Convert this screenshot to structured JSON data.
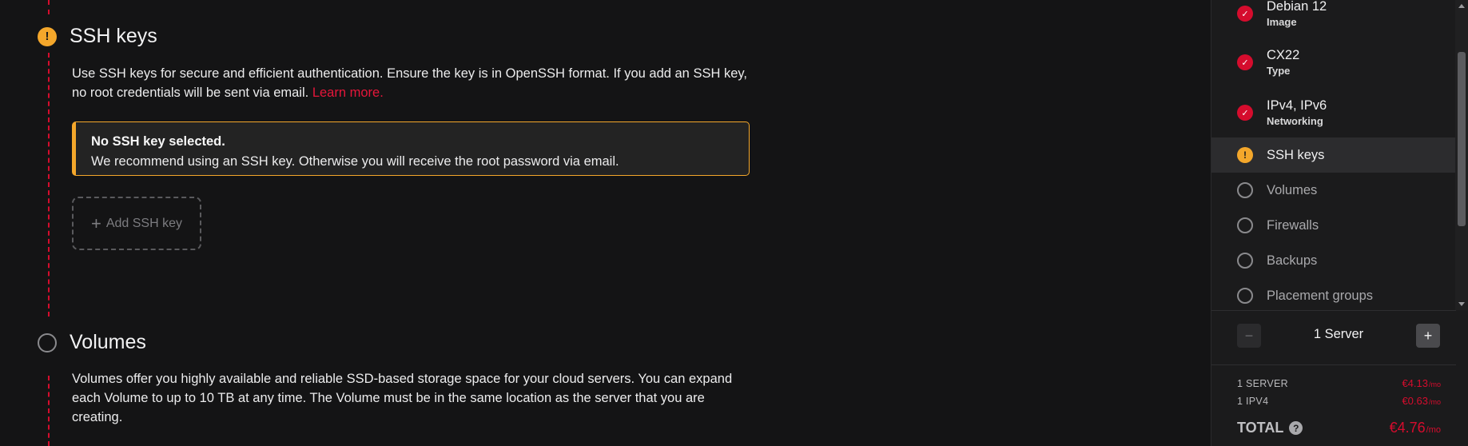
{
  "ssh_section": {
    "title": "SSH keys",
    "status_icon": "!",
    "description": "Use SSH keys for secure and efficient authentication. Ensure the key is in OpenSSH format. If you add an SSH key, no root credentials will be sent via email.",
    "learn_more": "Learn more.",
    "alert": {
      "title": "No SSH key selected.",
      "text": "We recommend using an SSH key. Otherwise you will receive the root password via email."
    },
    "add_button": {
      "icon": "+",
      "label": "Add SSH key"
    }
  },
  "volumes_section": {
    "title": "Volumes",
    "description": "Volumes offer you highly available and reliable SSD-based storage space for your cloud servers. You can expand each Volume to up to 10 TB at any time. The Volume must be in the same location as the server that you are creating."
  },
  "sidebar": {
    "steps": [
      {
        "label": "Debian 12",
        "sub": "Image",
        "status": "done",
        "icon": "✓"
      },
      {
        "label": "CX22",
        "sub": "Type",
        "status": "done",
        "icon": "✓"
      },
      {
        "label": "IPv4, IPv6",
        "sub": "Networking",
        "status": "done",
        "icon": "✓"
      },
      {
        "label": "SSH keys",
        "sub": "",
        "status": "warning",
        "icon": "!"
      },
      {
        "label": "Volumes",
        "sub": "",
        "status": "empty"
      },
      {
        "label": "Firewalls",
        "sub": "",
        "status": "empty"
      },
      {
        "label": "Backups",
        "sub": "",
        "status": "empty"
      },
      {
        "label": "Placement groups",
        "sub": "",
        "status": "empty"
      }
    ],
    "quantity": {
      "minus": "−",
      "plus": "+",
      "label": "1 Server"
    },
    "prices": [
      {
        "label": "1 SERVER",
        "value": "€4.13",
        "unit": "/mo"
      },
      {
        "label": "1 IPV4",
        "value": "€0.63",
        "unit": "/mo"
      }
    ],
    "total": {
      "label": "TOTAL",
      "help": "?",
      "value": "€4.76",
      "unit": "/mo"
    }
  },
  "colors": {
    "accent": "#d50c2d",
    "warning": "#f4a72b",
    "background": "#141415",
    "sidebar": "#1b1b1c"
  }
}
